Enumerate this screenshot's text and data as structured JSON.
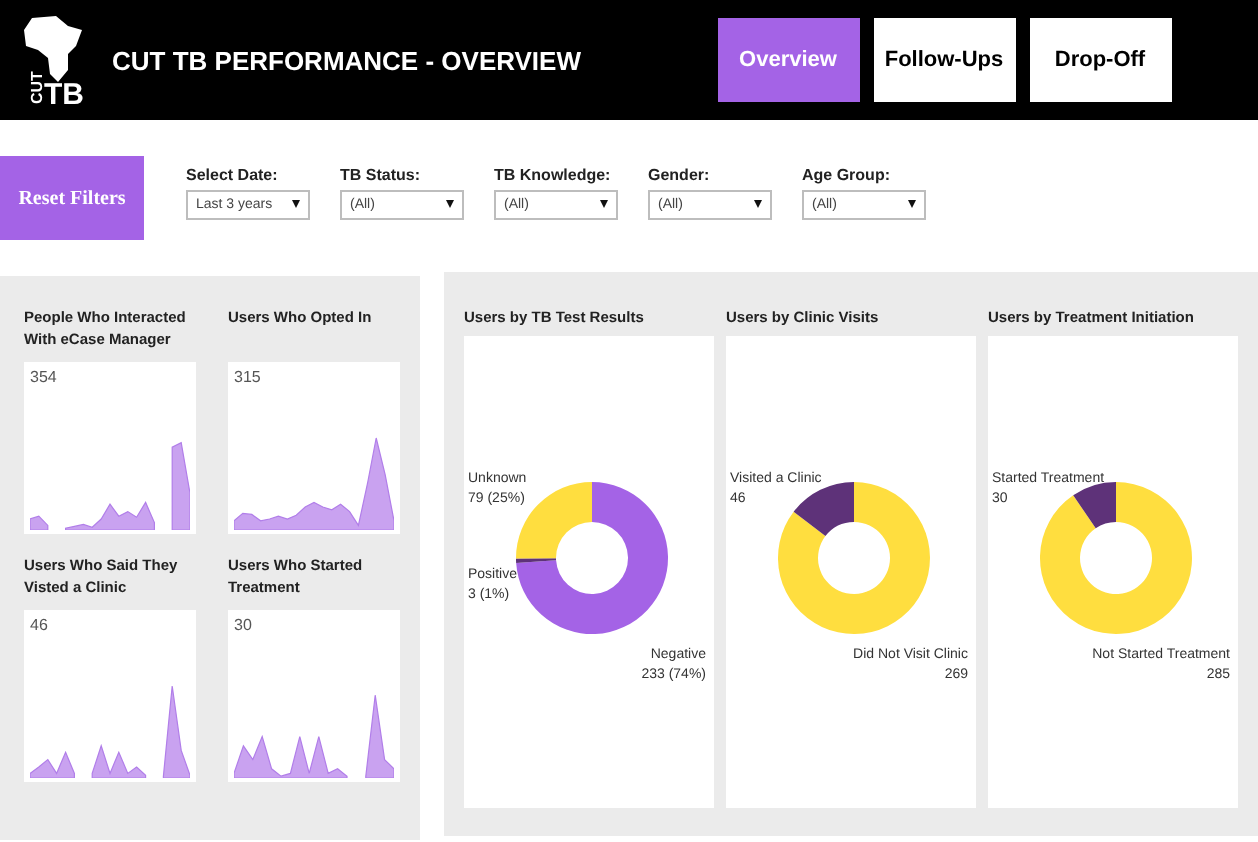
{
  "header": {
    "logo": [
      "CUT",
      "TB"
    ],
    "title": "CUT TB PERFORMANCE - OVERVIEW"
  },
  "tabs": [
    {
      "label": "Overview",
      "selected": true
    },
    {
      "label": "Follow-Ups",
      "selected": false
    },
    {
      "label": "Drop-Off",
      "selected": false
    }
  ],
  "reset_button": "Reset Filters",
  "filters": [
    {
      "label": "Select Date:",
      "value": "Last 3 years"
    },
    {
      "label": "TB Status:",
      "value": "(All)"
    },
    {
      "label": "TB Knowledge:",
      "value": "(All)"
    },
    {
      "label": "Gender:",
      "value": "(All)"
    },
    {
      "label": "Age Group:",
      "value": "(All)"
    }
  ],
  "kpi_cards": [
    {
      "title": "People Who Interacted With eCase Manager",
      "total": "354"
    },
    {
      "title": "Users Who Opted In",
      "total": "315"
    },
    {
      "title": "Users Who Said They Visted a Clinic",
      "total": "46"
    },
    {
      "title": "Users Who Started Treatment",
      "total": "30"
    }
  ],
  "donut_panels": [
    {
      "title": "Users by TB Test Results",
      "chart_data": {
        "type": "donut",
        "categories": [
          "Negative",
          "Positive",
          "Unknown"
        ],
        "values": [
          233,
          3,
          79
        ],
        "colors": [
          "#a463e6",
          "#5e3279",
          "#ffde3f"
        ],
        "value_labels": [
          "233 (74%)",
          "3 (1%)",
          "79 (25%)"
        ]
      }
    },
    {
      "title": "Users by Clinic Visits",
      "chart_data": {
        "type": "donut",
        "categories": [
          "Did Not Visit Clinic",
          "Visited a Clinic"
        ],
        "values": [
          269,
          46
        ],
        "colors": [
          "#ffde3f",
          "#5e3279"
        ],
        "value_labels": [
          "269",
          "46"
        ]
      }
    },
    {
      "title": "Users by Treatment Initiation",
      "chart_data": {
        "type": "donut",
        "categories": [
          "Not Started Treatment",
          "Started Treatment"
        ],
        "values": [
          285,
          30
        ],
        "colors": [
          "#ffde3f",
          "#5e3279"
        ],
        "value_labels": [
          "285",
          "30"
        ]
      }
    }
  ]
}
